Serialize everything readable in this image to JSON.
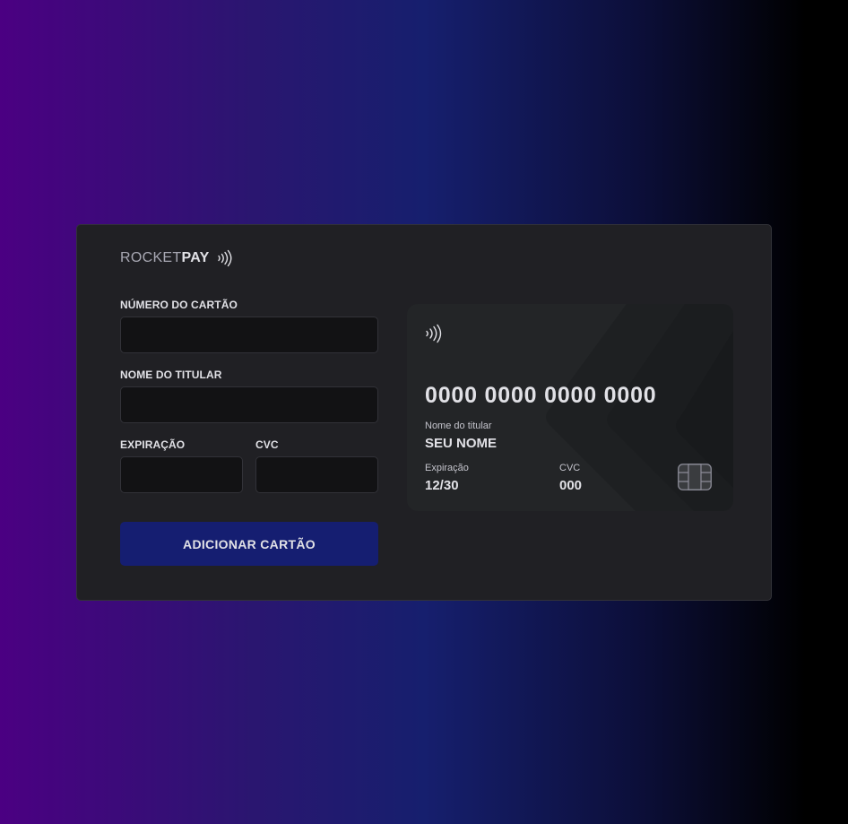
{
  "brand": {
    "name_light": "ROCKET",
    "name_bold": "PAY",
    "icon": "contactless-icon"
  },
  "form": {
    "card_number": {
      "label": "NÚMERO DO CARTÃO",
      "value": "",
      "placeholder": ""
    },
    "holder_name": {
      "label": "NOME DO TITULAR",
      "value": "",
      "placeholder": ""
    },
    "expiration": {
      "label": "EXPIRAÇÃO",
      "value": "",
      "placeholder": ""
    },
    "cvc": {
      "label": "CVC",
      "value": "",
      "placeholder": ""
    },
    "submit_label": "ADICIONAR CARTÃO"
  },
  "card_preview": {
    "contactless_icon": "contactless-icon",
    "number": "0000 0000 0000 0000",
    "holder_label": "Nome do titular",
    "holder_value": "SEU NOME",
    "expiration_label": "Expiração",
    "expiration_value": "12/30",
    "cvc_label": "CVC",
    "cvc_value": "000",
    "chip_icon": "card-chip-icon"
  },
  "colors": {
    "panel_bg": "#202024",
    "input_bg": "#121214",
    "button_bg": "#151e71",
    "card_bg": "#232527",
    "gradient_start": "#4b0082",
    "gradient_end": "#000000"
  }
}
